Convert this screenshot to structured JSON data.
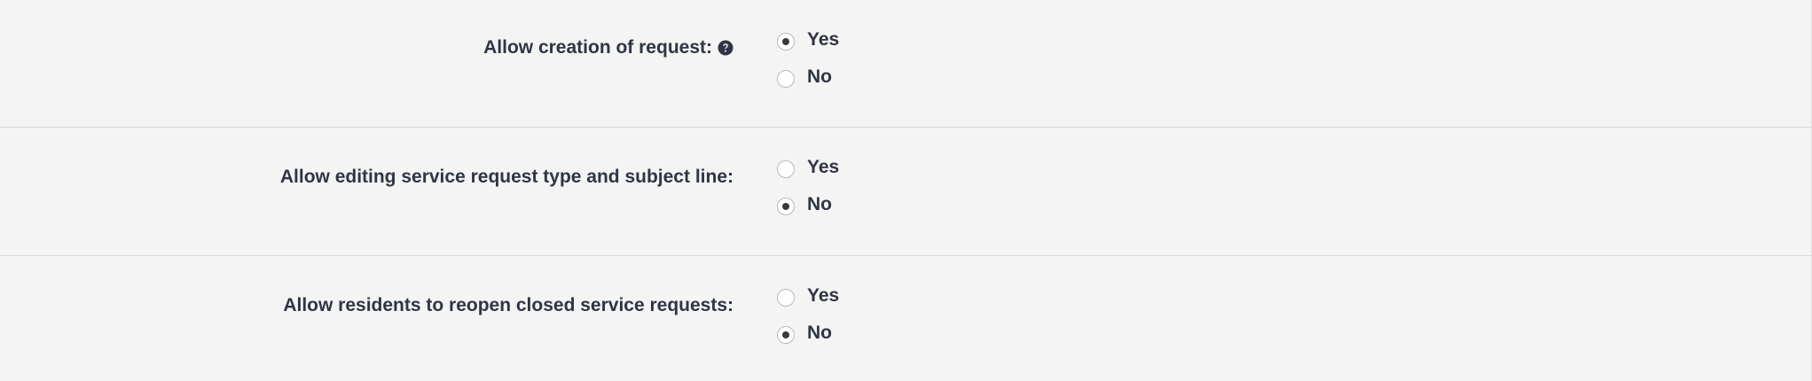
{
  "settings": [
    {
      "label": "Allow creation of request:",
      "has_help_icon": true,
      "options": [
        {
          "label": "Yes",
          "checked": true
        },
        {
          "label": "No",
          "checked": false
        }
      ]
    },
    {
      "label": "Allow editing service request type and subject line:",
      "has_help_icon": false,
      "options": [
        {
          "label": "Yes",
          "checked": false
        },
        {
          "label": "No",
          "checked": true
        }
      ]
    },
    {
      "label": "Allow residents to reopen closed service requests:",
      "has_help_icon": false,
      "options": [
        {
          "label": "Yes",
          "checked": false
        },
        {
          "label": "No",
          "checked": true
        }
      ]
    }
  ],
  "icons": {
    "help": "question-circle-icon"
  },
  "colors": {
    "background": "#f4f4f4",
    "text": "#2f3542",
    "divider": "#d8d8d8",
    "radio_border": "#b9b9b9",
    "radio_dot": "#3a3a3a"
  }
}
